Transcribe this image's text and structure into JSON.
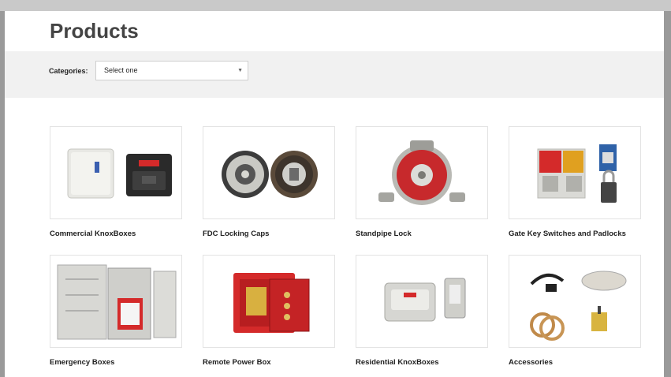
{
  "page": {
    "title": "Products"
  },
  "filter": {
    "label": "Categories:",
    "select_value": "Select one"
  },
  "products": [
    {
      "label": "Commercial KnoxBoxes",
      "icon": "commercial-knoxbox-image"
    },
    {
      "label": "FDC Locking Caps",
      "icon": "fdc-locking-caps-image"
    },
    {
      "label": "Standpipe Lock",
      "icon": "standpipe-lock-image"
    },
    {
      "label": "Gate Key Switches and Padlocks",
      "icon": "gate-key-switches-image"
    },
    {
      "label": "Emergency Boxes",
      "icon": "emergency-boxes-image"
    },
    {
      "label": "Remote Power Box",
      "icon": "remote-power-box-image"
    },
    {
      "label": "Residential KnoxBoxes",
      "icon": "residential-knoxbox-image"
    },
    {
      "label": "Accessories",
      "icon": "accessories-image"
    }
  ],
  "colors": {
    "accent_red": "#d42a2a",
    "background": "#ffffff",
    "filter_bar": "#f1f1f1"
  }
}
